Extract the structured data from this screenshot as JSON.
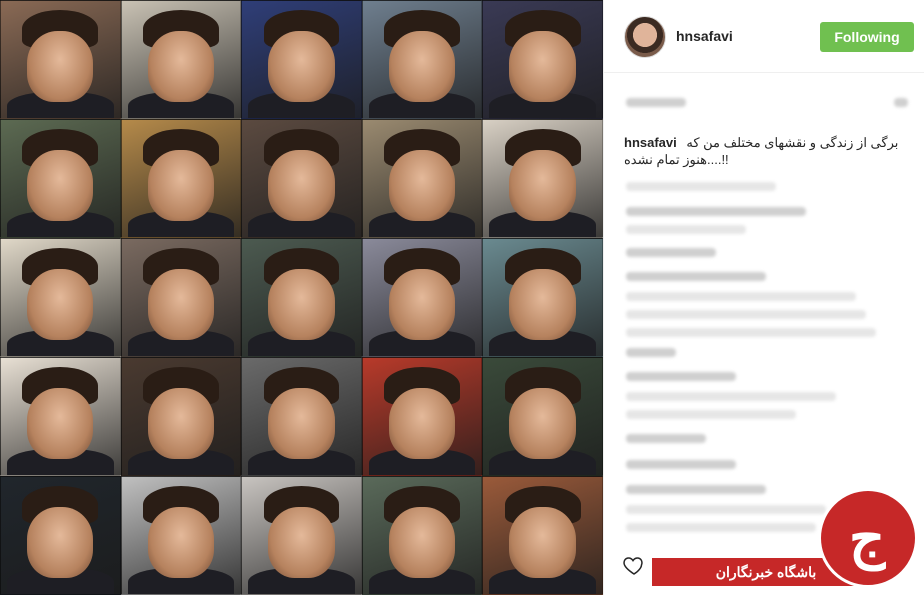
{
  "post": {
    "username": "hnsafavi",
    "follow_label": "Following",
    "caption_author": "hnsafavi",
    "caption_text": "برگی از زندگی و نقشهای مختلف من که هنوز تمام نشده....!!"
  },
  "watermark": {
    "label": "باشگاه خبرنگاران",
    "glyph": "ج"
  },
  "colors": {
    "follow_button": "#70c050",
    "brand_red": "#c62828"
  }
}
